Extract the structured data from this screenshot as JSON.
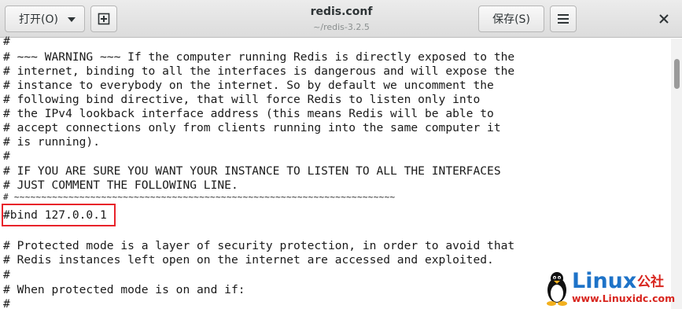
{
  "window": {
    "title": "redis.conf",
    "subtitle": "~/redis-3.2.5"
  },
  "toolbar": {
    "open_label": "打开(O)",
    "save_label": "保存(S)"
  },
  "editor": {
    "lines": [
      "#",
      "# ~~~ WARNING ~~~ If the computer running Redis is directly exposed to the",
      "# internet, binding to all the interfaces is dangerous and will expose the",
      "# instance to everybody on the internet. So by default we uncomment the",
      "# following bind directive, that will force Redis to listen only into",
      "# the IPv4 lookback interface address (this means Redis will be able to",
      "# accept connections only from clients running into the same computer it",
      "# is running).",
      "#",
      "# IF YOU ARE SURE YOU WANT YOUR INSTANCE TO LISTEN TO ALL THE INTERFACES",
      "# JUST COMMENT THE FOLLOWING LINE.",
      "# ~~~~~~~~~~~~~~~~~~~~~~~~~~~~~~~~~~~~~~~~~~~~~~~~~~~~~~~~~~~~~~~~~~~~~~",
      "#bind 127.0.0.1",
      "",
      "# Protected mode is a layer of security protection, in order to avoid that",
      "# Redis instances left open on the internet are accessed and exploited.",
      "#",
      "# When protected mode is on and if:",
      "#"
    ],
    "highlighted_line": "#bind 127.0.0.1",
    "highlight_color": "#e8232a"
  },
  "watermark": {
    "brand": "Linux",
    "brand_cn": "公社",
    "url": "www.Linuxidc.com"
  },
  "icons": {
    "new_document": "new-document-icon",
    "hamburger": "hamburger-menu-icon",
    "close": "close-icon",
    "dropdown": "chevron-down-icon",
    "tux": "tux-penguin-icon"
  }
}
